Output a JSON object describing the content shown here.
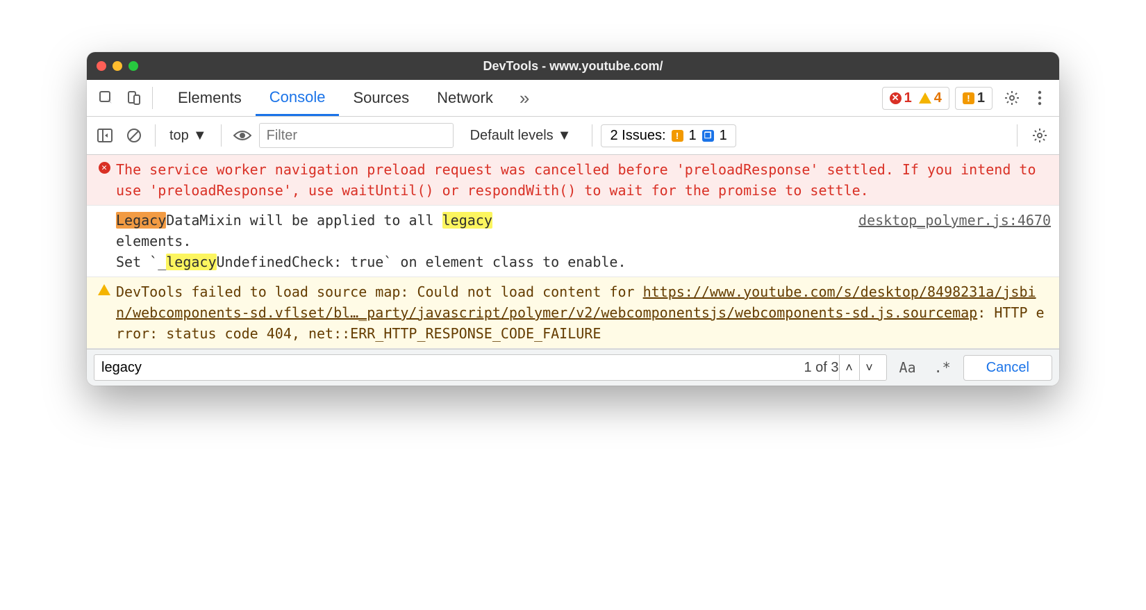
{
  "title": "DevTools - www.youtube.com/",
  "tabs": [
    "Elements",
    "Console",
    "Sources",
    "Network"
  ],
  "active_tab": "Console",
  "status": {
    "errors": "1",
    "warnings": "4",
    "issues": "1"
  },
  "context": "top",
  "filter_placeholder": "Filter",
  "levels_label": "Default levels",
  "issues_bar": {
    "label": "2 Issues:",
    "orange": "1",
    "blue": "1"
  },
  "messages": {
    "error": "The service worker navigation preload request was cancelled before 'preloadResponse' settled. If you intend to use 'preloadResponse', use waitUntil() or respondWith() to wait for the promise to settle.",
    "log_parts": {
      "hl_legacy_cap": "Legacy",
      "after_cap": "DataMixin will be applied to all ",
      "hl_legacy": "legacy",
      "line1_rest": " elements.",
      "line2_pre": "Set `_",
      "line2_hl": "legacy",
      "line2_post": "UndefinedCheck: true` on element class to enable."
    },
    "log_src": "desktop_polymer.js:4670",
    "warn_pre": "DevTools failed to load source map: Could not load content for ",
    "warn_link": "https://www.youtube.com/s/desktop/8498231a/jsbin/webcomponents-sd.vflset/bl…_party/javascript/polymer/v2/webcomponentsjs/webcomponents-sd.js.sourcemap",
    "warn_post": ": HTTP error: status code 404, net::ERR_HTTP_RESPONSE_CODE_FAILURE"
  },
  "find": {
    "query": "legacy",
    "count": "1 of 3",
    "aa": "Aa",
    "regex": ".*",
    "cancel": "Cancel"
  }
}
